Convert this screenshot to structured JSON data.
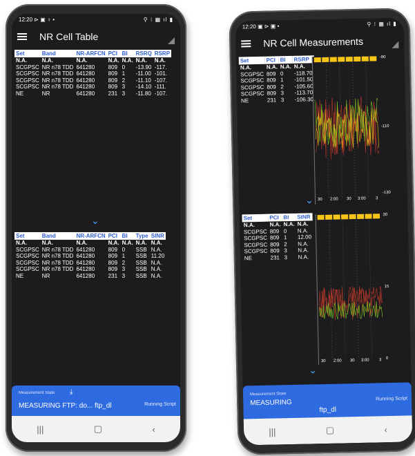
{
  "left": {
    "status": {
      "time": "12:20",
      "icons_left": "⊳ ▣ ♀ •",
      "icons_right": "⚲ ⁝ ▦ ıl ▮"
    },
    "title": "NR Cell Table",
    "table1": {
      "headers": [
        "Set",
        "Band",
        "NR-ARFCN",
        "PCI",
        "BI",
        "RSRQ",
        "RSRP"
      ],
      "rows": [
        [
          "N.A.",
          "N.A.",
          "N.A.",
          "N.A.",
          "N.A.",
          "N.A.",
          "N.A."
        ],
        [
          "SCGPSC",
          "NR n78 TDD",
          "641280",
          "809",
          "0",
          "-13.90",
          "-117."
        ],
        [
          "SCGPSC",
          "NR n78 TDD",
          "641280",
          "809",
          "1",
          "-11.00",
          "-101."
        ],
        [
          "SCGPSC",
          "NR n78 TDD",
          "641280",
          "809",
          "2",
          "-11.10",
          "-107."
        ],
        [
          "SCGPSC",
          "NR n78 TDD",
          "641280",
          "809",
          "3",
          "-14.10",
          "-111."
        ],
        [
          "NE",
          "NR",
          "641280",
          "231",
          "3",
          "-11.80",
          "-107."
        ]
      ]
    },
    "table2": {
      "headers": [
        "Set",
        "Band",
        "NR-ARFCN",
        "PCI",
        "BI",
        "Type",
        "SINR"
      ],
      "rows": [
        [
          "N.A.",
          "N.A.",
          "N.A.",
          "N.A.",
          "N.A.",
          "N.A.",
          "N.A."
        ],
        [
          "SCGPSC",
          "NR n78 TDD",
          "641280",
          "809",
          "0",
          "SSB",
          "N.A."
        ],
        [
          "SCGPSC",
          "NR n78 TDD",
          "641280",
          "809",
          "1",
          "SSB",
          "11.20"
        ],
        [
          "SCGPSC",
          "NR n78 TDD",
          "641280",
          "809",
          "2",
          "SSB",
          "N.A."
        ],
        [
          "SCGPSC",
          "NR n78 TDD",
          "641280",
          "809",
          "3",
          "SSB",
          "N.A."
        ],
        [
          "NE",
          "NR",
          "641280",
          "231",
          "3",
          "SSB",
          "N.A."
        ]
      ]
    },
    "bottom": {
      "label": "Measurement State",
      "value": "MEASURING FTP: do... ftp_dl",
      "script": "Running Script"
    },
    "nav": {
      "recent": "|||",
      "home": "▢",
      "back": "‹"
    }
  },
  "right": {
    "status": {
      "time": "12:20",
      "icons_left": "▣ ⊳ ▣ •",
      "icons_right": "⚲ ⁝ ▦ ıl ▮"
    },
    "title": "NR Cell Measurements",
    "table1": {
      "headers": [
        "Set",
        "PCI",
        "BI",
        "RSRP"
      ],
      "rows": [
        [
          "N.A.",
          "N.A.",
          "N.A.",
          "N.A."
        ],
        [
          "SCGPSC",
          "809",
          "0",
          "-118.70"
        ],
        [
          "SCGPSC",
          "809",
          "1",
          "-101.50"
        ],
        [
          "SCGPSC",
          "809",
          "2",
          "-105.60"
        ],
        [
          "SCGPSC",
          "809",
          "3",
          "-113.70"
        ],
        [
          "NE",
          "231",
          "3",
          "-106.30"
        ]
      ]
    },
    "table2": {
      "headers": [
        "Set",
        "PCI",
        "BI",
        "SINR"
      ],
      "rows": [
        [
          "N.A.",
          "N.A.",
          "N.A.",
          "N.A."
        ],
        [
          "SCGPSC",
          "809",
          "0",
          "N.A."
        ],
        [
          "SCGPSC",
          "809",
          "1",
          "12.00"
        ],
        [
          "SCGPSC",
          "809",
          "2",
          "N.A."
        ],
        [
          "SCGPSC",
          "809",
          "3",
          "N.A."
        ],
        [
          "NE",
          "231",
          "3",
          "N.A."
        ]
      ]
    },
    "chart1": {
      "y_ticks": [
        "-90",
        "-110",
        "-130"
      ],
      "x_ticks": [
        "30",
        "2:00",
        "30",
        "3:00",
        "3"
      ]
    },
    "chart2": {
      "y_ticks": [
        "30",
        "15",
        "0"
      ],
      "x_ticks": [
        "30",
        "2:00",
        "30",
        "3:00",
        "3"
      ]
    },
    "bottom": {
      "label": "Measurement State",
      "value": "MEASURING",
      "center": "ftp_dl",
      "script": "Running Script"
    },
    "nav": {
      "recent": "|||",
      "home": "▢",
      "back": "‹"
    }
  },
  "colors": {
    "accent": "#2e6ae0",
    "header_text": "#2f5fd0",
    "chart_red": "#c0392b",
    "chart_green": "#7ed321",
    "chart_yellow": "#f5c518"
  }
}
